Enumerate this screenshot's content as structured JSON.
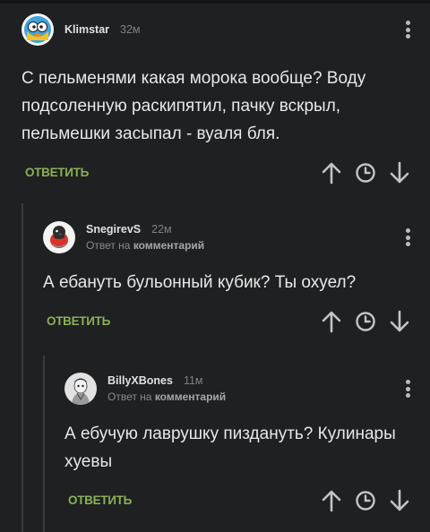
{
  "comments": [
    {
      "username": "Klimstar",
      "time": "32м",
      "text": "С пельменями какая морока вообще? Воду подсоленную раскипятил, пачку вскрыл, пельмешки засыпал - вуаля бля.",
      "reply_label": "ОТВЕТИТЬ"
    },
    {
      "username": "SnegirevS",
      "time": "22м",
      "reply_prefix": "Ответ на",
      "reply_target": "комментарий",
      "text": "А ебануть бульонный кубик? Ты охуел?",
      "reply_label": "ОТВЕТИТЬ"
    },
    {
      "username": "BillyXBones",
      "time": "11м",
      "reply_prefix": "Ответ на",
      "reply_target": "комментарий",
      "text": "А ебучую лаврушку пиздануть? Кулинары хуевы",
      "reply_label": "ОТВЕТИТЬ"
    }
  ],
  "icons": {
    "more": "kebab-menu-icon",
    "upvote": "arrow-up-icon",
    "save": "clock-icon",
    "downvote": "arrow-down-icon"
  },
  "colors": {
    "background": "#1f2021",
    "reply_green": "#8ab158",
    "icon_gray": "#c4c4c4"
  }
}
